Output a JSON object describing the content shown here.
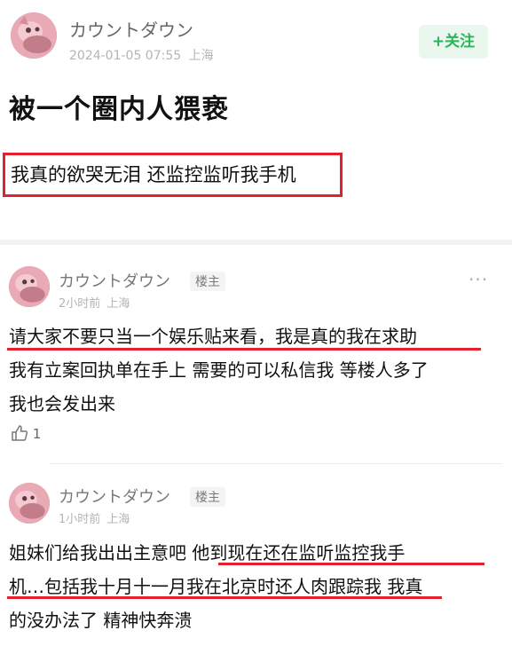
{
  "post": {
    "author": "カウントダウン",
    "timestamp": "2024-01-05 07:55",
    "location": "上海",
    "follow_label": "+关注",
    "title": "被一个圈内人猥亵",
    "body": "我真的欲哭无泪 还监控监听我手机"
  },
  "comments": [
    {
      "author": "カウントダウン",
      "badge": "楼主",
      "time": "2小时前",
      "location": "上海",
      "lines": [
        "请大家不要只当一个娱乐贴来看，我是真的我在求助",
        "我有立案回执单在手上 需要的可以私信我 等楼人多了",
        "我也会发出来"
      ],
      "likes": "1"
    },
    {
      "author": "カウントダウン",
      "badge": "楼主",
      "time": "1小时前",
      "location": "上海",
      "lines": [
        "姐妹们给我出出主意吧 他到现在还在监听监控我手",
        "机…包括我十月十一月我在北京时还人肉跟踪我 我真",
        "的没办法了 精神快奔溃"
      ]
    }
  ],
  "icons": {
    "more": "more-horizontal-icon",
    "like": "thumbs-up-icon",
    "avatar": "pink-character-avatar"
  },
  "colors": {
    "highlight": "#e5202e",
    "follow_green": "#2db35a"
  },
  "more_glyph": "···"
}
